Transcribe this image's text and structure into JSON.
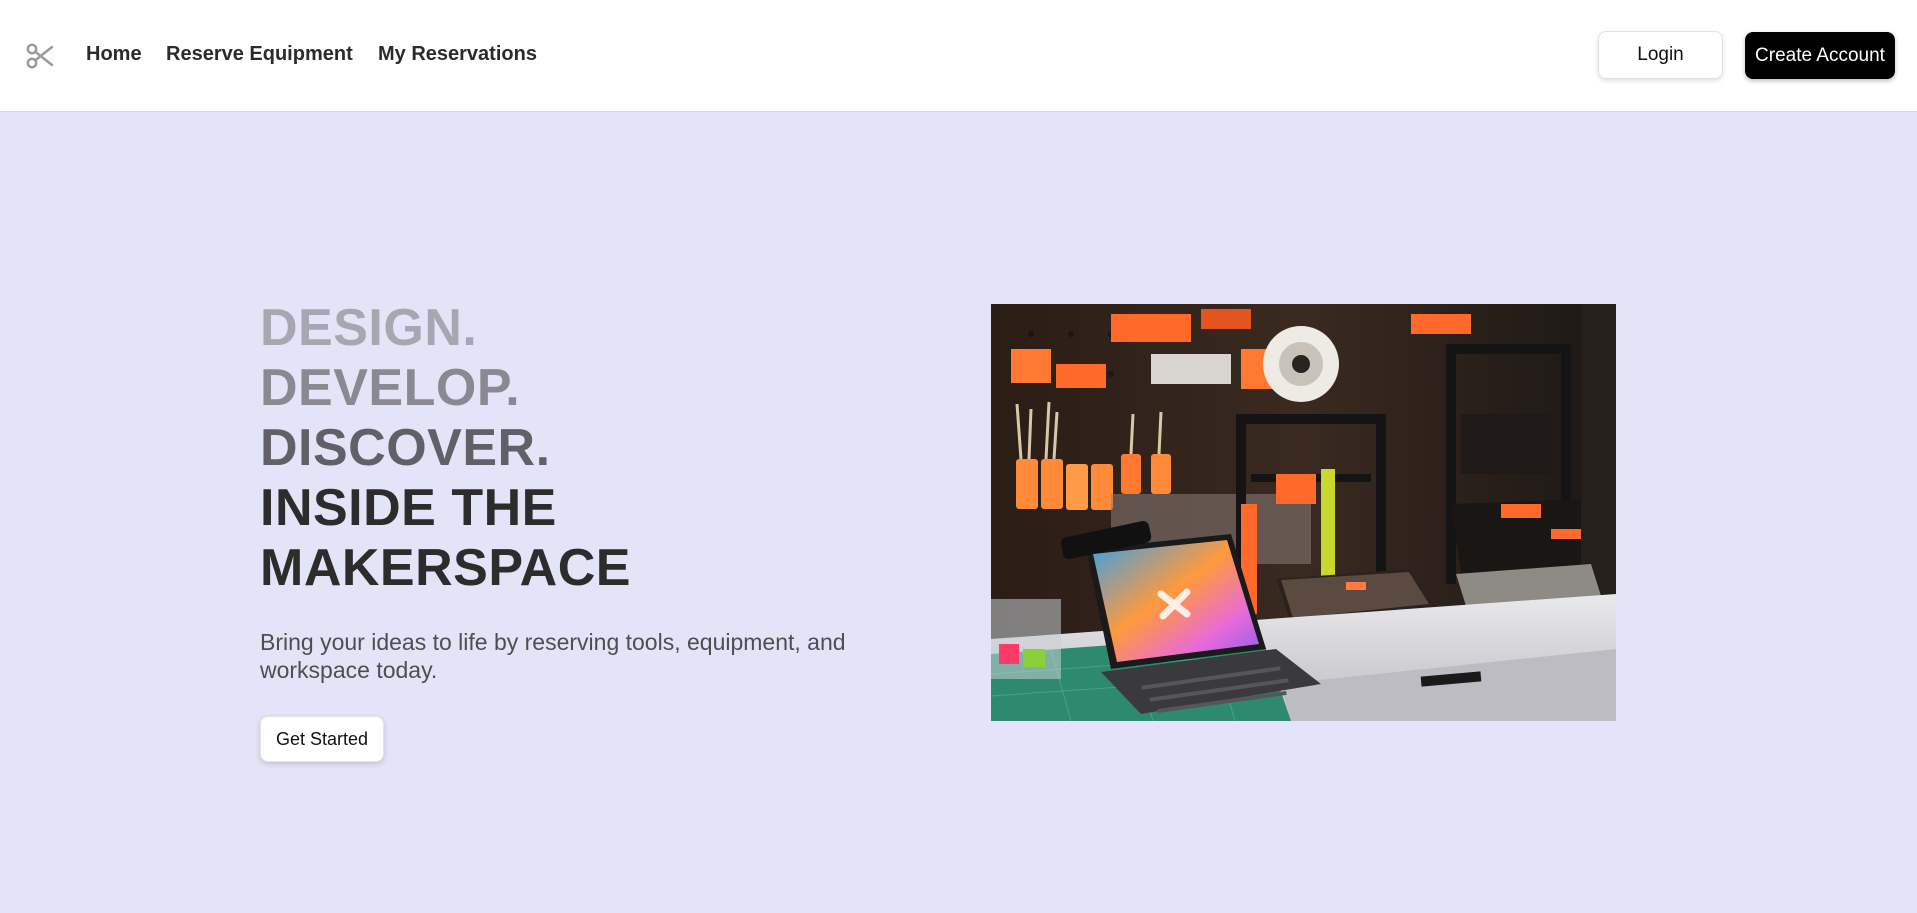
{
  "nav": {
    "logo_icon": "scissors-icon",
    "links": [
      {
        "label": "Home"
      },
      {
        "label": "Reserve Equipment"
      },
      {
        "label": "My Reservations"
      }
    ],
    "login_label": "Login",
    "create_account_label": "Create Account"
  },
  "hero": {
    "headline_1": "DESIGN.",
    "headline_2": "DEVELOP.",
    "headline_3": "DISCOVER.",
    "headline_4": "INSIDE THE MAKERSPACE",
    "subtitle": "Bring your ideas to life by reserving tools, equipment, and workspace today.",
    "cta_label": "Get Started",
    "image": "makerspace-3d-printer-workbench-photo"
  },
  "colors": {
    "page_background": "#e4e4f8",
    "navbar_background": "#ffffff",
    "primary_button": "#000000",
    "headline_dark": "#2c2c2c"
  }
}
